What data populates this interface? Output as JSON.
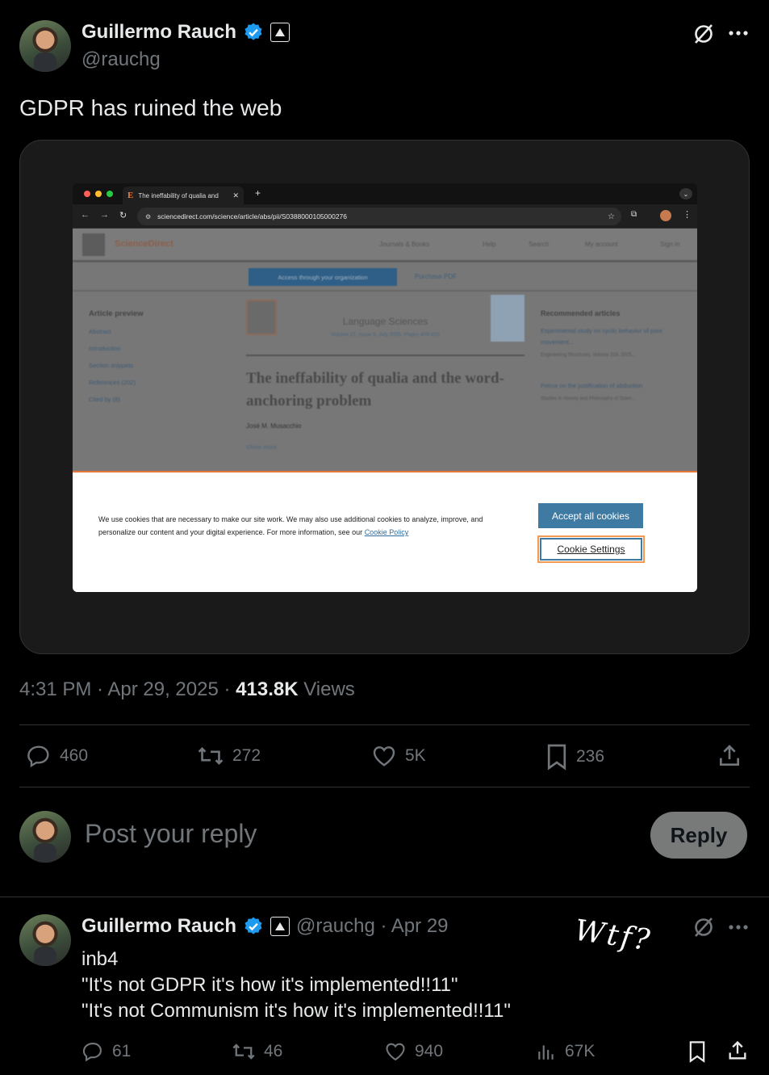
{
  "tweet": {
    "author_name": "Guillermo Rauch",
    "handle": "@rauchg",
    "text": "GDPR has ruined the web",
    "time": "4:31 PM · Apr 29, 2025 · ",
    "views_count": "413.8K",
    "views_label": " Views",
    "stats": {
      "replies": "460",
      "reposts": "272",
      "likes": "5K",
      "bookmarks": "236"
    }
  },
  "embedded": {
    "tab_title": "The ineffability of qualia and",
    "url": "sciencedirect.com/science/article/abs/pii/S0388000105000276",
    "site_name": "ScienceDirect",
    "nav": [
      "Journals & Books",
      "Help",
      "Search",
      "My account",
      "Sign in"
    ],
    "access_button": "Access through your organization",
    "purchase": "Purchase PDF",
    "sidebar_title": "Article preview",
    "sidebar_items": [
      "Abstract",
      "Introduction",
      "Section snippets",
      "References (202)",
      "Cited by (8)"
    ],
    "journal": "Language Sciences",
    "journal_meta": "Volume 27, Issue 5, July 2005, Pages 409-430",
    "article_title": "The ineffability of qualia and the word-anchoring problem",
    "author": "José M. Musacchio",
    "show_more": "Show more",
    "recommended_title": "Recommended articles",
    "recommended": [
      "Experimental study on cyclic behavior of pore movement...",
      "Engineering Structures, Volume 328, 2025...",
      "Peirce on the justification of abduction",
      "Studies in History and Philosophy of Scien..."
    ],
    "cookie_text": "We use cookies that are necessary to make our site work. We may also use additional cookies to analyze, improve, and personalize our content and your digital experience. For more information, see our ",
    "cookie_link": "Cookie Policy",
    "accept_button": "Accept all cookies",
    "settings_button": "Cookie Settings"
  },
  "compose": {
    "placeholder": "Post your reply",
    "reply_button": "Reply"
  },
  "reply": {
    "author_name": "Guillermo Rauch",
    "handle_date": "@rauchg · Apr 29",
    "line1": "inb4",
    "line2": "\"It's not GDPR it's how it's implemented!!11\"",
    "line3": "\"It's not Communism it's how it's implemented!!11\"",
    "annotation": "Wtf?",
    "stats": {
      "replies": "61",
      "reposts": "46",
      "likes": "940",
      "views": "67K"
    }
  },
  "colors": {
    "background": "#000000",
    "text": "#e7e9ea",
    "muted": "#71767b",
    "verified": "#1d9bf0",
    "divider": "#2f3336"
  }
}
